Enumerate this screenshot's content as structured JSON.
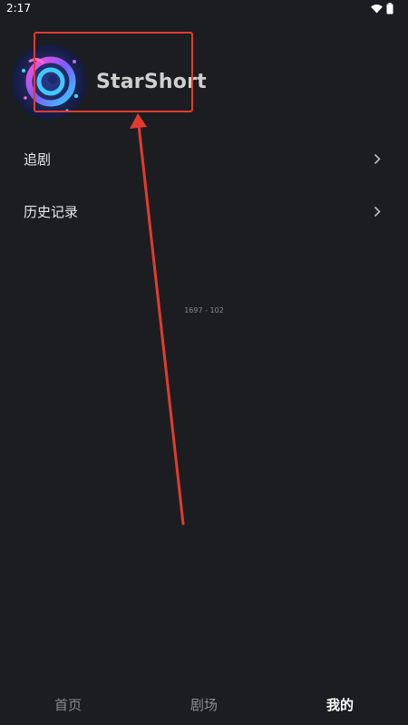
{
  "status_bar": {
    "time": "2:17",
    "icons": [
      "wifi-icon",
      "battery-icon"
    ]
  },
  "profile": {
    "app_name": "StarShort",
    "avatar": "galaxy-logo"
  },
  "menu": [
    {
      "label": "追剧",
      "icon": "chevron-right-icon"
    },
    {
      "label": "历史记录",
      "icon": "chevron-right-icon"
    }
  ],
  "watermark": "1697 - 102",
  "annotation": {
    "color": "#e23b2e",
    "type": "arrow-to-box"
  },
  "bottom_nav": {
    "tabs": [
      {
        "label": "首页",
        "active": false
      },
      {
        "label": "剧场",
        "active": false
      },
      {
        "label": "我的",
        "active": true
      }
    ]
  },
  "colors": {
    "background": "#1c1d21",
    "text": "#e6e6e6",
    "accent": "#e23b2e"
  }
}
